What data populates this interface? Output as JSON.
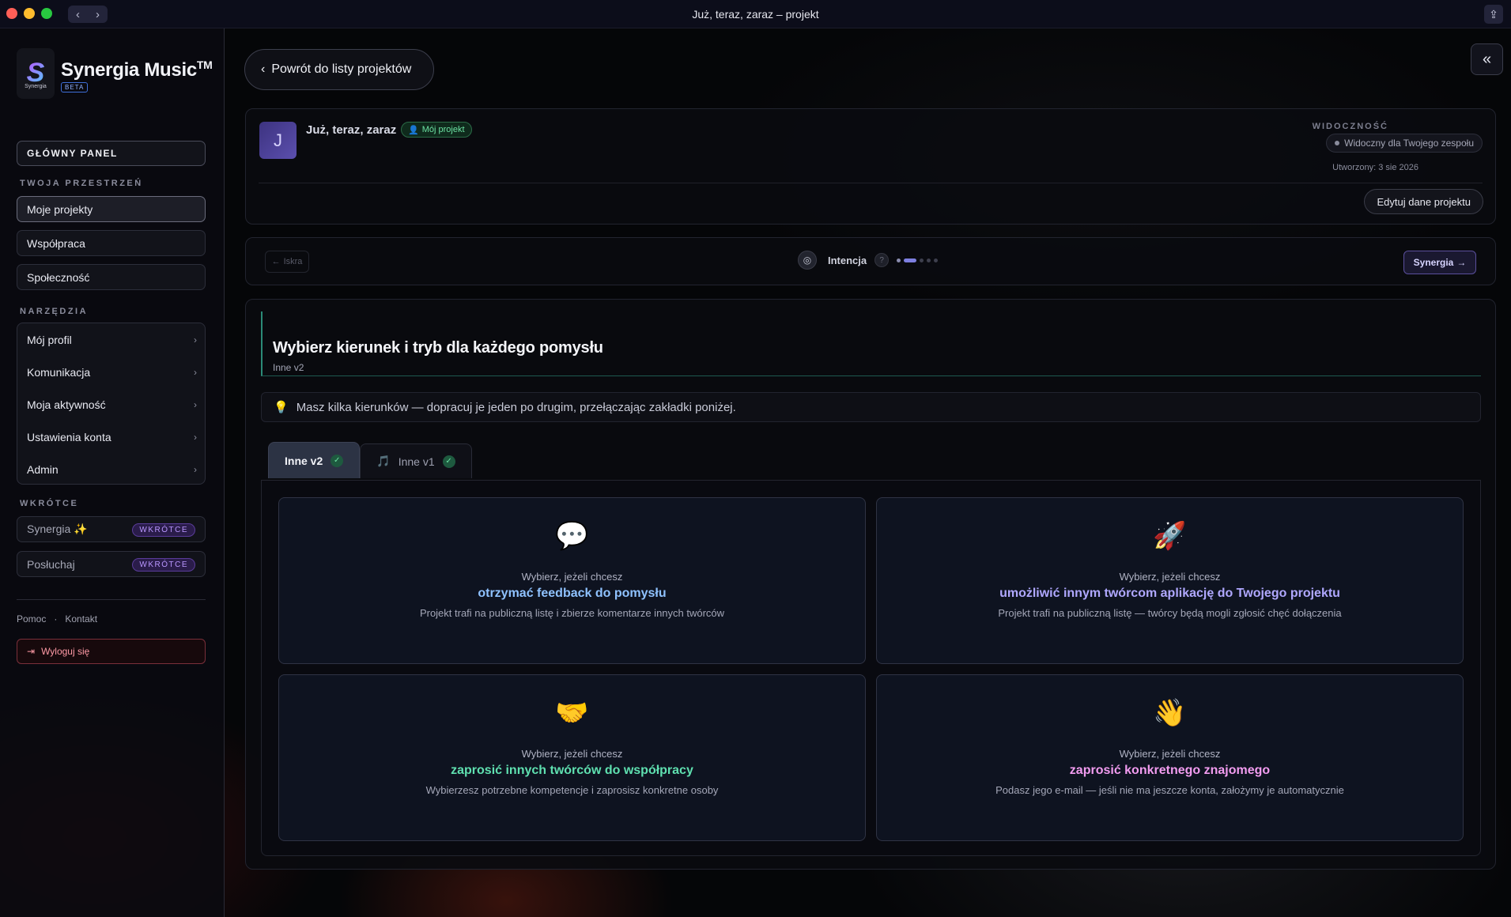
{
  "window": {
    "title": "Już, teraz, zaraz – projekt"
  },
  "brand": {
    "name": "Synergia Music",
    "tm": "TM",
    "badge": "BETA",
    "logo_text": "Synergia"
  },
  "sidebar": {
    "main_panel": "GŁÓWNY PANEL",
    "workspace_label": "TWOJA PRZESTRZEŃ",
    "workspace_items": [
      {
        "label": "Moje projekty",
        "active": true
      },
      {
        "label": "Współpraca",
        "active": false
      },
      {
        "label": "Społeczność",
        "active": false
      }
    ],
    "tools_label": "NARZĘDZIA",
    "tools_items": [
      {
        "label": "Mój profil"
      },
      {
        "label": "Komunikacja"
      },
      {
        "label": "Moja aktywność"
      },
      {
        "label": "Ustawienia konta"
      },
      {
        "label": "Admin"
      }
    ],
    "soon_label": "WKRÓTCE",
    "soon_items": [
      {
        "label": "Synergia ✨",
        "badge": "WKRÓTCE"
      },
      {
        "label": "Posłuchaj",
        "badge": "WKRÓTCE"
      }
    ],
    "footer": {
      "help": "Pomoc",
      "separator": "·",
      "contact": "Kontakt"
    },
    "logout": "Wyloguj się"
  },
  "header": {
    "back_label": "Powrót do listy projektów"
  },
  "project": {
    "avatar_letter": "J",
    "title": "Już, teraz, zaraz",
    "owner_badge": "Mój projekt",
    "visibility_label": "WIDOCZNOŚĆ",
    "visibility_value": "Widoczny dla Twojego zespołu",
    "created": "Utworzony: 3 sie 2026",
    "edit_label": "Edytuj dane projektu"
  },
  "stepper": {
    "prev_label": "Iskra",
    "current_step": "Intencja",
    "help_glyph": "?",
    "next_label": "Synergia"
  },
  "main": {
    "heading": "Wybierz kierunek i tryb dla każdego pomysłu",
    "subheading": "Inne v2",
    "tip": "Masz kilka kierunków — dopracuj je jeden po drugim, przełączając zakładki poniżej.",
    "tabs": [
      {
        "label": "Inne v2",
        "active": true
      },
      {
        "label": "Inne v1",
        "active": false
      }
    ],
    "options": [
      {
        "icon": "💬",
        "pre": "Wybierz, jeżeli chcesz",
        "title": "otrzymać feedback do pomysłu",
        "desc": "Projekt trafi na publiczną listę i zbierze komentarze innych twórców",
        "color": "#8fc2ff"
      },
      {
        "icon": "🚀",
        "pre": "Wybierz, jeżeli chcesz",
        "title": "umożliwić innym twórcom aplikację do Twojego projektu",
        "desc": "Projekt trafi na publiczną listę — twórcy będą mogli zgłosić chęć dołączenia",
        "color": "#b0a8ff"
      },
      {
        "icon": "🤝",
        "pre": "Wybierz, jeżeli chcesz",
        "title": "zaprosić innych twórców do współpracy",
        "desc": "Wybierzesz potrzebne kompetencje i zaprosisz konkretne osoby",
        "color": "#5fe0b0"
      },
      {
        "icon": "👋",
        "pre": "Wybierz, jeżeli chcesz",
        "title": "zaprosić konkretnego znajomego",
        "desc": "Podasz jego e-mail — jeśli nie ma jeszcze konta, założymy je automatycznie",
        "color": "#f29cf0"
      }
    ]
  }
}
